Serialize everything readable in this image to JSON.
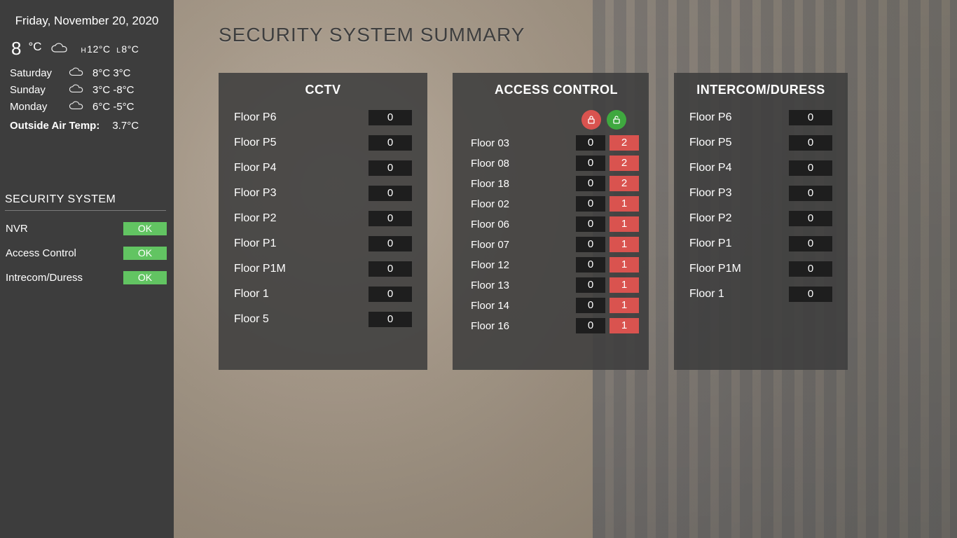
{
  "date": "Friday, November 20, 2020",
  "current": {
    "temp": "8",
    "unit": "°C",
    "hi": "12°C",
    "lo": "8°C"
  },
  "forecast": [
    {
      "day": "Saturday",
      "hi": "8°C",
      "lo": "3°C"
    },
    {
      "day": "Sunday",
      "hi": "3°C",
      "lo": "-8°C"
    },
    {
      "day": "Monday",
      "hi": "6°C",
      "lo": "-5°C"
    }
  ],
  "oat_label": "Outside Air Temp:",
  "oat_value": "3.7°C",
  "security_heading": "SECURITY SYSTEM",
  "security_status": [
    {
      "name": "NVR",
      "status": "OK"
    },
    {
      "name": "Access Control",
      "status": "OK"
    },
    {
      "name": "Intrecom/Duress",
      "status": "OK"
    }
  ],
  "page_title": "SECURITY SYSTEM SUMMARY",
  "panels": {
    "cctv": {
      "title": "CCTV",
      "rows": [
        {
          "label": "Floor P6",
          "value": "0"
        },
        {
          "label": "Floor P5",
          "value": "0"
        },
        {
          "label": "Floor P4",
          "value": "0"
        },
        {
          "label": "Floor P3",
          "value": "0"
        },
        {
          "label": "Floor P2",
          "value": "0"
        },
        {
          "label": "Floor P1",
          "value": "0"
        },
        {
          "label": "Floor P1M",
          "value": "0"
        },
        {
          "label": "Floor 1",
          "value": "0"
        },
        {
          "label": "Floor 5",
          "value": "0"
        }
      ]
    },
    "access": {
      "title": "ACCESS CONTROL",
      "rows": [
        {
          "label": "Floor 03",
          "locked": "0",
          "unlocked": "2"
        },
        {
          "label": "Floor 08",
          "locked": "0",
          "unlocked": "2"
        },
        {
          "label": "Floor 18",
          "locked": "0",
          "unlocked": "2"
        },
        {
          "label": "Floor 02",
          "locked": "0",
          "unlocked": "1"
        },
        {
          "label": "Floor 06",
          "locked": "0",
          "unlocked": "1"
        },
        {
          "label": "Floor 07",
          "locked": "0",
          "unlocked": "1"
        },
        {
          "label": "Floor 12",
          "locked": "0",
          "unlocked": "1"
        },
        {
          "label": "Floor 13",
          "locked": "0",
          "unlocked": "1"
        },
        {
          "label": "Floor 14",
          "locked": "0",
          "unlocked": "1"
        },
        {
          "label": "Floor 16",
          "locked": "0",
          "unlocked": "1"
        }
      ]
    },
    "intercom": {
      "title": "INTERCOM/DURESS",
      "rows": [
        {
          "label": "Floor P6",
          "value": "0"
        },
        {
          "label": "Floor P5",
          "value": "0"
        },
        {
          "label": "Floor P4",
          "value": "0"
        },
        {
          "label": "Floor P3",
          "value": "0"
        },
        {
          "label": "Floor P2",
          "value": "0"
        },
        {
          "label": "Floor P1",
          "value": "0"
        },
        {
          "label": "Floor P1M",
          "value": "0"
        },
        {
          "label": "Floor 1",
          "value": "0"
        }
      ]
    }
  },
  "colors": {
    "ok": "#62c462",
    "alert": "#d9534f"
  }
}
